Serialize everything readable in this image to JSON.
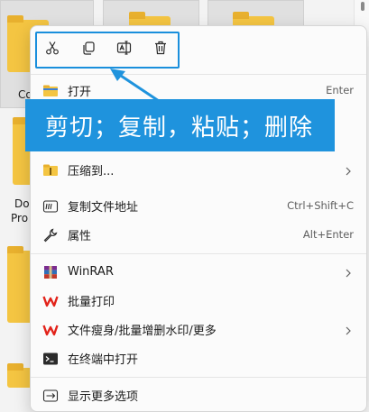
{
  "background": {
    "labels": [
      "Co",
      "Do",
      "Pro"
    ]
  },
  "toolbar": {
    "buttons": [
      {
        "icon": "cut-icon"
      },
      {
        "icon": "copy-icon"
      },
      {
        "icon": "rename-icon"
      },
      {
        "icon": "delete-icon"
      }
    ]
  },
  "menu": {
    "open": {
      "label": "打开",
      "shortcut": "Enter"
    },
    "compress": {
      "label": "压缩到..."
    },
    "copy_path": {
      "label": "复制文件地址",
      "shortcut": "Ctrl+Shift+C"
    },
    "properties": {
      "label": "属性",
      "shortcut": "Alt+Enter"
    },
    "winrar": {
      "label": "WinRAR"
    },
    "batch_print": {
      "label": "批量打印"
    },
    "wps_tools": {
      "label": "文件瘦身/批量增删水印/更多"
    },
    "terminal": {
      "label": "在终端中打开"
    },
    "more_options": {
      "label": "显示更多选项"
    }
  },
  "annotation": {
    "text": "剪切；复制，粘贴；删除"
  },
  "colors": {
    "accent": "#1f93dd",
    "folder": "#f4c542",
    "wps_red": "#e2231a"
  }
}
